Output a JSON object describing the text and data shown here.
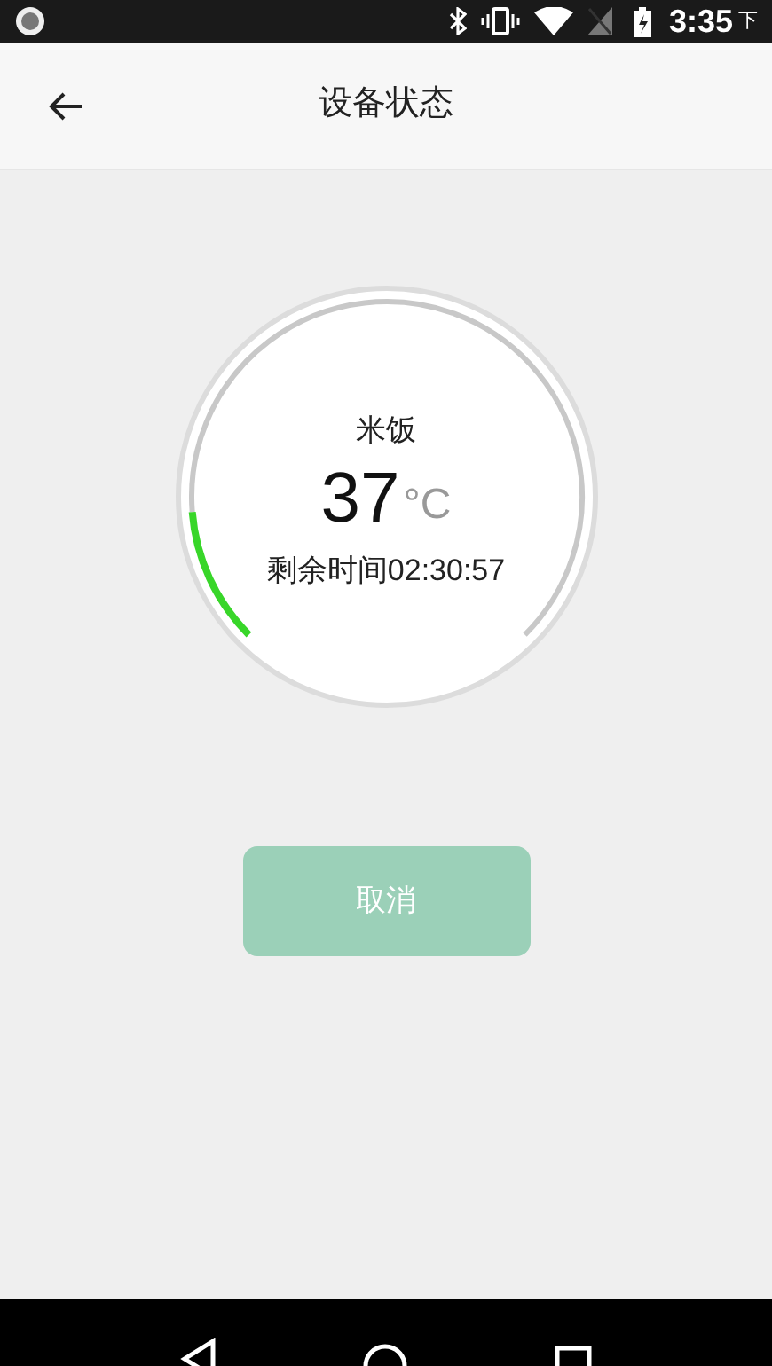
{
  "status_bar": {
    "time": "3:35",
    "period": "下"
  },
  "header": {
    "title": "设备状态"
  },
  "gauge": {
    "food": "米饭",
    "temperature": "37",
    "unit": "°C",
    "remaining": "剩余时间02:30:57"
  },
  "cancel_button": {
    "label": "取消"
  }
}
